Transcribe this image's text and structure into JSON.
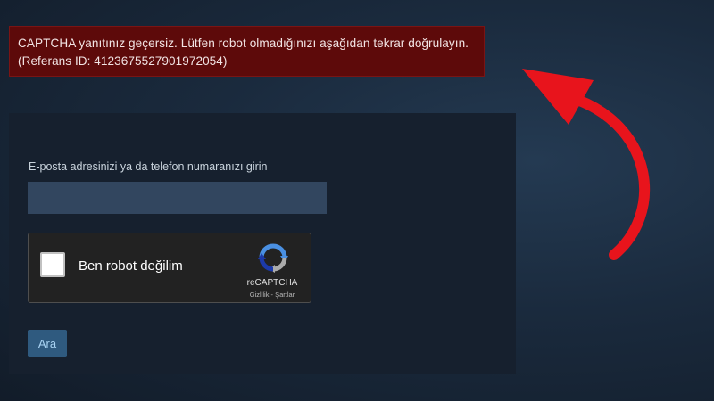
{
  "error": {
    "line1": "CAPTCHA yanıtınız geçersiz. Lütfen robot olmadığınızı aşağıdan tekrar doğrulayın.",
    "line2": "(Referans ID: 4123675527901972054)",
    "background_color": "#5d0a0a"
  },
  "form": {
    "email_label": "E-posta adresinizi ya da telefon numaranızı girin",
    "email_value": "",
    "submit_label": "Ara"
  },
  "recaptcha": {
    "checkbox_label": "Ben robot değilim",
    "brand": "reCAPTCHA",
    "links": "Gizlilik - Şartlar",
    "icon": "recaptcha-logo-icon"
  },
  "annotation": {
    "arrow_color": "#e8141c",
    "icon": "curved-arrow-icon"
  }
}
